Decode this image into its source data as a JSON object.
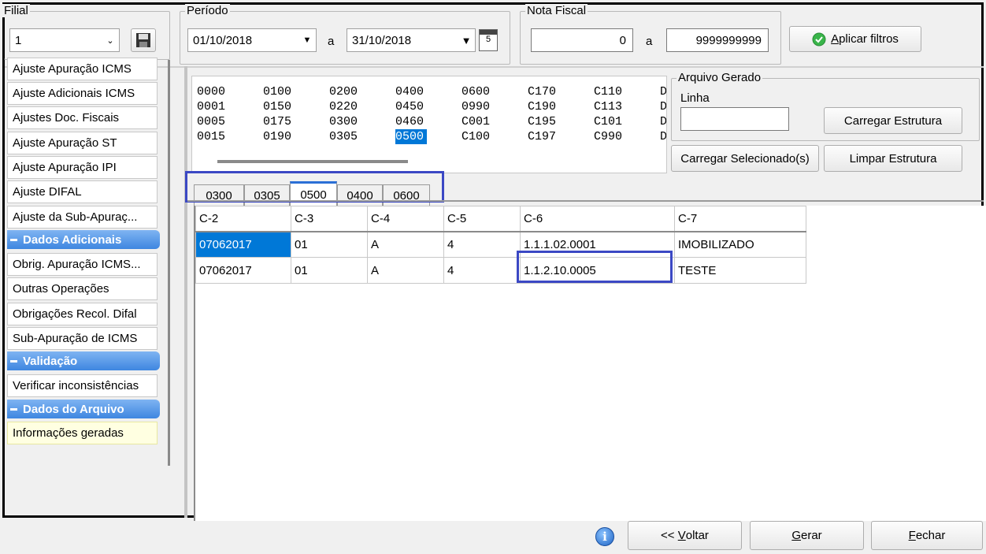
{
  "filial": {
    "label": "Filial",
    "value": "1"
  },
  "periodo": {
    "label": "Período",
    "start": "01/10/2018",
    "sep": "a",
    "end": "31/10/2018"
  },
  "nota_fiscal": {
    "label": "Nota Fiscal",
    "start": "0",
    "sep": "a",
    "end": "9999999999"
  },
  "apply_button": {
    "label_first": "A",
    "label_rest": "plicar filtros"
  },
  "sidebar": {
    "items_top": [
      "Ajuste Apuração ICMS",
      "Ajuste Adicionais ICMS",
      "Ajustes Doc. Fiscais",
      "Ajuste Apuração ST",
      "Ajuste Apuração IPI",
      "Ajuste DIFAL",
      "Ajuste da Sub-Apuraç..."
    ],
    "section_dados_adicionais": "Dados Adicionais",
    "items_dados_adicionais": [
      "Obrig. Apuração ICMS...",
      "Outras Operações",
      "Obrigações Recol. Difal",
      "Sub-Apuração de ICMS"
    ],
    "section_validacao": "Validação",
    "items_validacao": [
      "Verificar inconsistências"
    ],
    "section_dados_arquivo": "Dados do Arquivo",
    "items_dados_arquivo": [
      "Informações geradas"
    ]
  },
  "structure": {
    "columns": [
      [
        "0000",
        "0001",
        "0005",
        "0015"
      ],
      [
        "0100",
        "0150",
        "0175",
        "0190"
      ],
      [
        "0200",
        "0220",
        "0300",
        "0305"
      ],
      [
        "0400",
        "0450",
        "0460",
        "0500"
      ],
      [
        "0600",
        "0990",
        "C001",
        "C100"
      ],
      [
        "C170",
        "C190",
        "C195",
        "C197"
      ],
      [
        "C110",
        "C113",
        "C101",
        "C990"
      ],
      [
        "D",
        "D",
        "D",
        "D"
      ]
    ],
    "selected": "0500"
  },
  "arquivo_gerado": {
    "label": "Arquivo Gerado",
    "linha_label": "Linha",
    "linha_value": "",
    "carregar_estrutura": "Carregar Estrutura",
    "carregar_selecionados": "Carregar Selecionado(s)",
    "limpar_estrutura": "Limpar Estrutura"
  },
  "tabs": [
    "0300",
    "0305",
    "0500",
    "0400",
    "0600"
  ],
  "active_tab": "0500",
  "table": {
    "headers": [
      "C-2",
      "C-3",
      "C-4",
      "C-5",
      "C-6",
      "C-7"
    ],
    "rows": [
      [
        "07062017",
        "01",
        "A",
        "4",
        "1.1.1.02.0001",
        "IMOBILIZADO"
      ],
      [
        "07062017",
        "01",
        "A",
        "4",
        "1.1.2.10.0005",
        "TESTE"
      ]
    ]
  },
  "footer": {
    "voltar_prefix": "<< ",
    "voltar_first": "V",
    "voltar_rest": "oltar",
    "gerar_first": "G",
    "gerar_rest": "erar",
    "fechar_first": "F",
    "fechar_rest": "echar"
  },
  "colors": {
    "accent": "#0078d7",
    "highlight": "#3b48c4",
    "section": "#3e86e0"
  }
}
